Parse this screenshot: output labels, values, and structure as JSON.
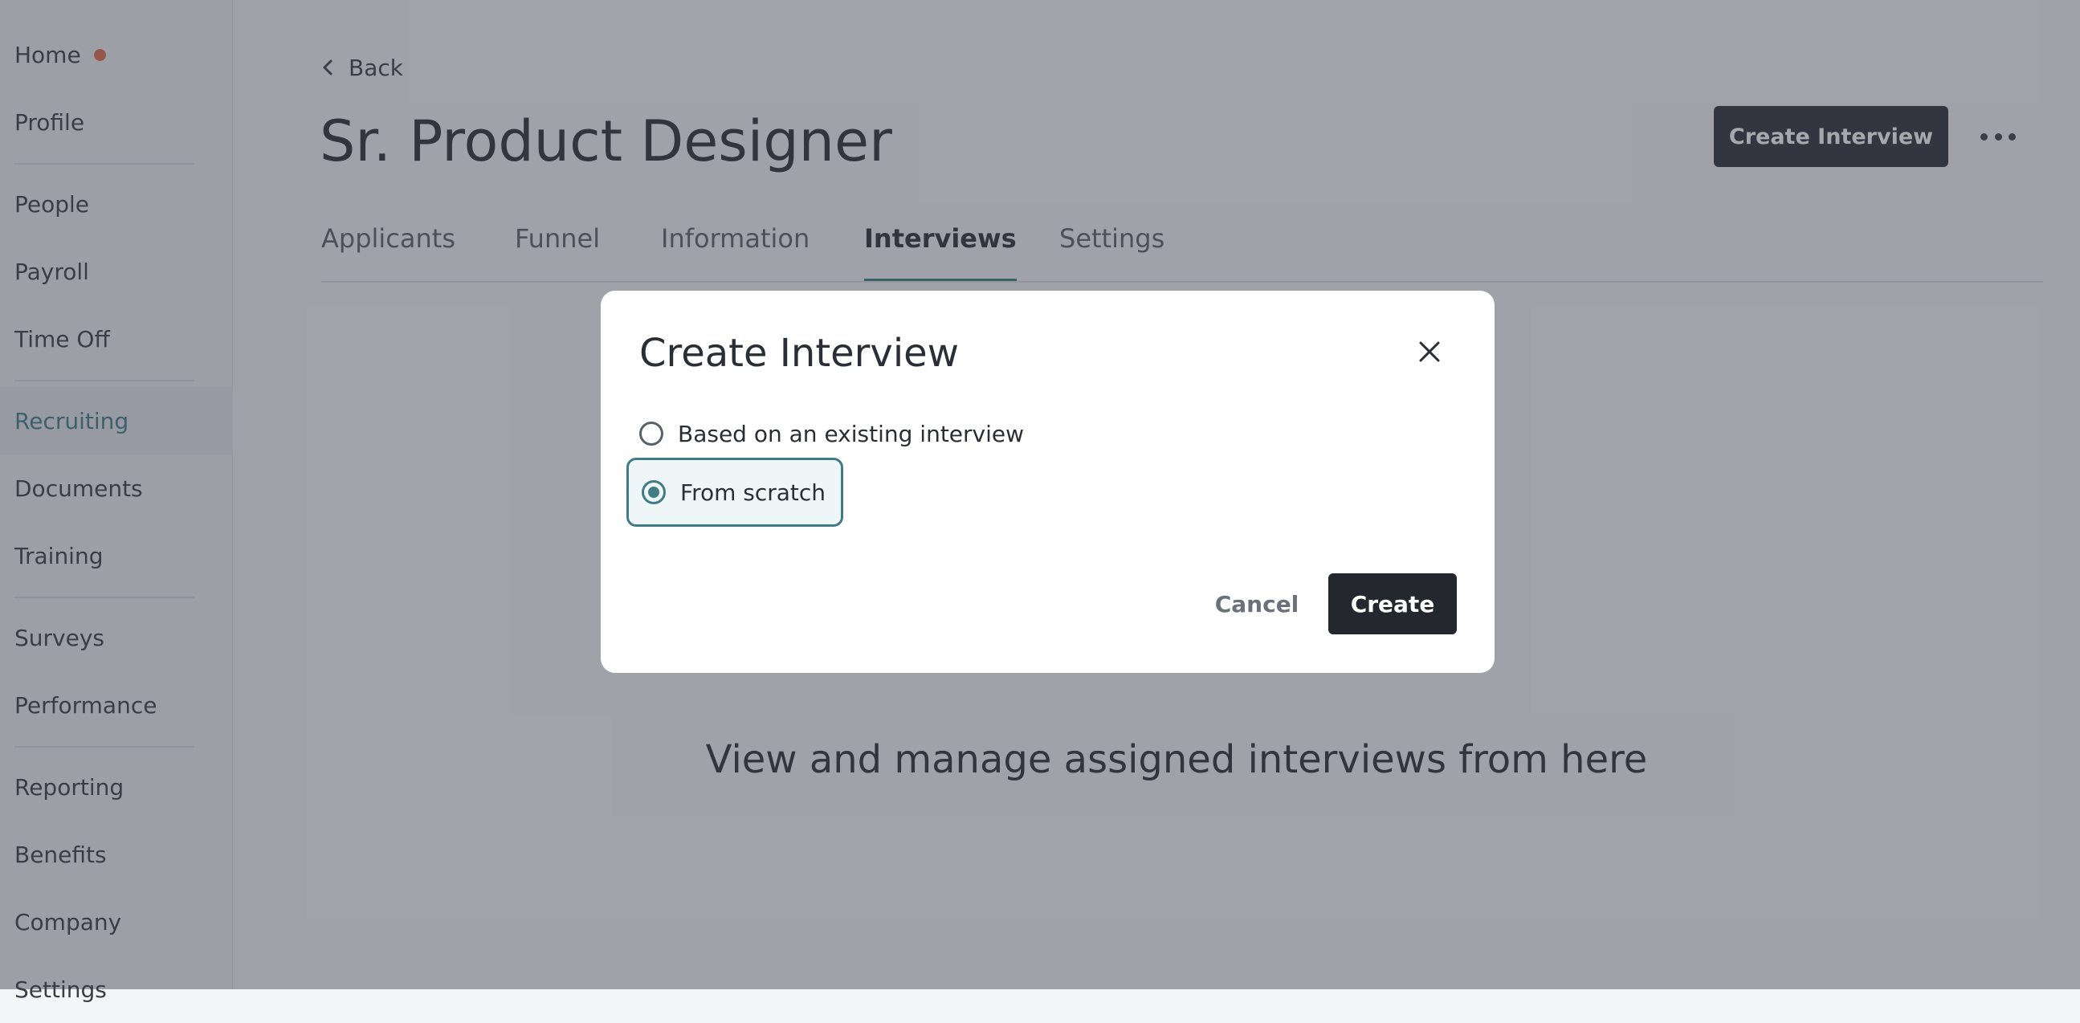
{
  "sidebar": {
    "items": [
      {
        "label": "Home"
      },
      {
        "label": "Profile"
      },
      {
        "label": "People"
      },
      {
        "label": "Payroll"
      },
      {
        "label": "Time Off"
      },
      {
        "label": "Recruiting"
      },
      {
        "label": "Documents"
      },
      {
        "label": "Training"
      },
      {
        "label": "Surveys"
      },
      {
        "label": "Performance"
      },
      {
        "label": "Reporting"
      },
      {
        "label": "Benefits"
      },
      {
        "label": "Company"
      },
      {
        "label": "Settings"
      }
    ],
    "active": "Recruiting"
  },
  "header": {
    "back_label": "Back",
    "title": "Sr. Product Designer",
    "create_button_label": "Create Interview"
  },
  "tabs": [
    {
      "label": "Applicants"
    },
    {
      "label": "Funnel"
    },
    {
      "label": "Information"
    },
    {
      "label": "Interviews"
    },
    {
      "label": "Settings"
    }
  ],
  "active_tab": "Interviews",
  "main": {
    "empty_text": "View and manage assigned interviews from here"
  },
  "modal": {
    "title": "Create Interview",
    "options": [
      {
        "label": "Based on an existing interview",
        "selected": false
      },
      {
        "label": "From scratch",
        "selected": true
      }
    ],
    "cancel_label": "Cancel",
    "create_label": "Create"
  },
  "colors": {
    "accent": "#3f7c86",
    "notification": "#e26b4e",
    "primary_button": "#25272e"
  }
}
